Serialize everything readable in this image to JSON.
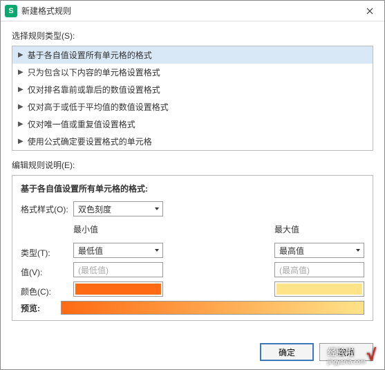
{
  "window": {
    "title": "新建格式规则",
    "app_icon_letter": "S"
  },
  "section": {
    "select_type_label": "选择规则类型(S):",
    "edit_desc_label": "编辑规则说明(E):"
  },
  "rules": [
    "基于各自值设置所有单元格的格式",
    "只为包含以下内容的单元格设置格式",
    "仅对排名靠前或靠后的数值设置格式",
    "仅对高于或低于平均值的数值设置格式",
    "仅对唯一值或重复值设置格式",
    "使用公式确定要设置格式的单元格"
  ],
  "panel": {
    "title": "基于各自值设置所有单元格的格式:",
    "style_label": "格式样式(O):",
    "style_value": "双色刻度",
    "type_label": "类型(T):",
    "value_label": "值(V):",
    "color_label": "颜色(C):",
    "preview_label": "预览:",
    "min": {
      "header": "最小值",
      "type_value": "最低值",
      "value_placeholder": "(最低值)",
      "color": "#ff6a13"
    },
    "max": {
      "header": "最大值",
      "type_value": "最高值",
      "value_placeholder": "(最高值)",
      "color": "#ffe389"
    }
  },
  "buttons": {
    "ok": "确定",
    "cancel": "取消"
  },
  "watermark": {
    "text": "经验啦",
    "sub": "jingyanla.com"
  }
}
